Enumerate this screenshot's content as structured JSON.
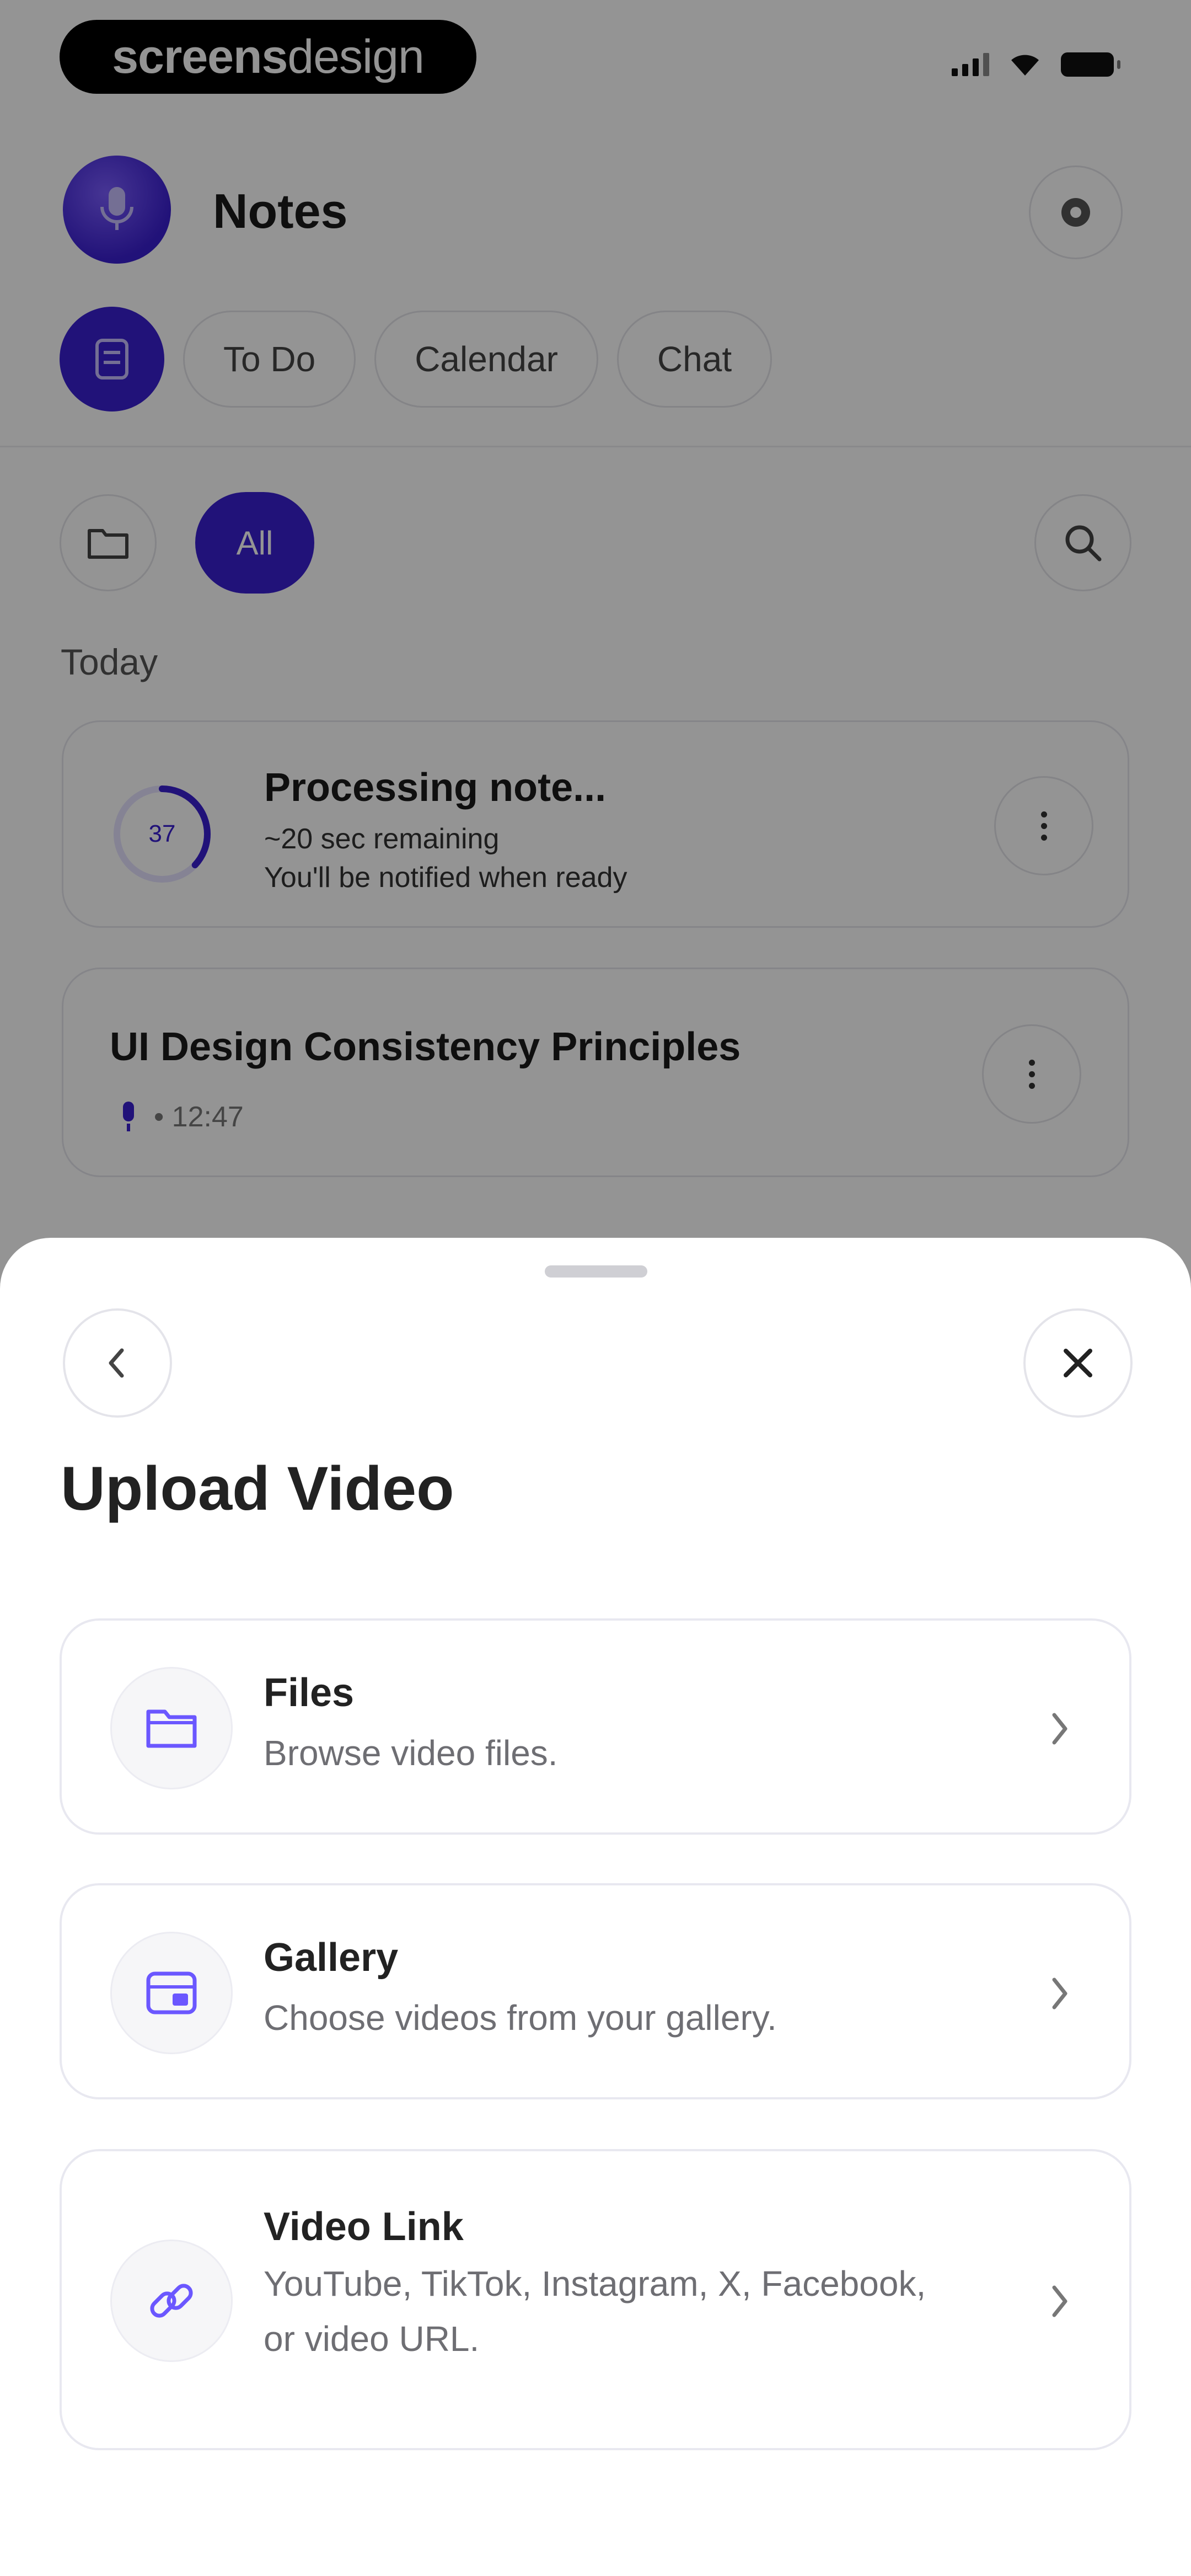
{
  "status_bar": {
    "brand_bold": "screens",
    "brand_light": "design"
  },
  "app": {
    "title": "Notes",
    "tabs": [
      {
        "label": "To Do"
      },
      {
        "label": "Calendar"
      },
      {
        "label": "Chat"
      }
    ],
    "filter": {
      "active_chip": "All"
    },
    "section_label": "Today",
    "processing_card": {
      "progress": 37,
      "progress_label": "37",
      "title": "Processing note...",
      "line1": "~20 sec remaining",
      "line2": "You'll be notified when ready"
    },
    "note_card": {
      "title": "UI Design Consistency Principles",
      "meta": "• 12:47"
    }
  },
  "sheet": {
    "title": "Upload Video",
    "options": [
      {
        "title": "Files",
        "description": "Browse video files.",
        "icon": "folder-icon"
      },
      {
        "title": "Gallery",
        "description": "Choose videos from your gallery.",
        "icon": "gallery-icon"
      },
      {
        "title": "Video Link",
        "description_line1": "YouTube, TikTok, Instagram, X, Facebook,",
        "description_line2": "or video URL.",
        "icon": "link-icon"
      }
    ]
  },
  "colors": {
    "accent": "#3a1fd0",
    "icon_accent": "#6b57ff",
    "overlay": "rgba(0,0,0,0.42)"
  }
}
